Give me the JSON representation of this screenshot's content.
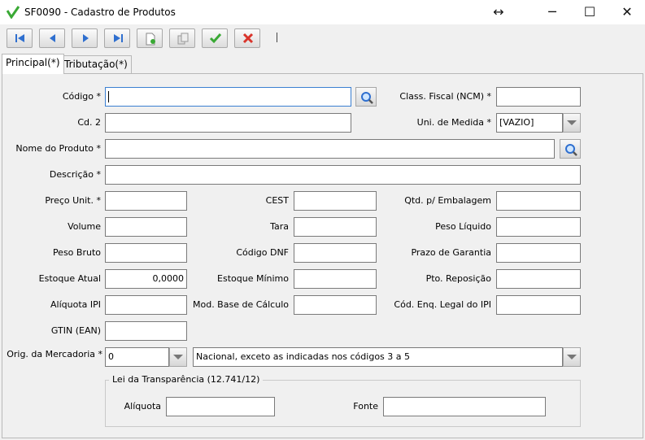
{
  "window": {
    "title": "SF0090 - Cadastro de Produtos",
    "resize_glyph": "↔",
    "minimize_glyph": "─",
    "maximize_glyph": "☐",
    "close_glyph": "✕"
  },
  "toolbar": {
    "buttons": [
      {
        "name": "first-record",
        "icon": "skip-first-icon"
      },
      {
        "name": "previous-record",
        "icon": "previous-icon"
      },
      {
        "name": "next-record",
        "icon": "next-icon"
      },
      {
        "name": "last-record",
        "icon": "skip-last-icon"
      },
      {
        "name": "new-record",
        "icon": "new-document-icon"
      },
      {
        "name": "copy-record",
        "icon": "copy-icon"
      },
      {
        "name": "confirm",
        "icon": "check-icon"
      },
      {
        "name": "cancel",
        "icon": "x-icon"
      }
    ],
    "separator": "|"
  },
  "tabs": [
    {
      "label": "Principal(*)",
      "active": true
    },
    {
      "label": "Tributação(*)",
      "active": false
    }
  ],
  "form": {
    "codigo": {
      "label": "Código *",
      "value": ""
    },
    "class_fiscal": {
      "label": "Class. Fiscal (NCM) *",
      "value": ""
    },
    "cd2": {
      "label": "Cd. 2",
      "value": ""
    },
    "uni_medida": {
      "label": "Uni. de Medida *",
      "value": "[VAZIO]"
    },
    "nome_produto": {
      "label": "Nome do Produto *",
      "value": ""
    },
    "descricao": {
      "label": "Descrição *",
      "value": ""
    },
    "preco_unit": {
      "label": "Preço Unit. *",
      "value": ""
    },
    "cest": {
      "label": "CEST",
      "value": ""
    },
    "qtd_embalagem": {
      "label": "Qtd. p/ Embalagem",
      "value": ""
    },
    "volume": {
      "label": "Volume",
      "value": ""
    },
    "tara": {
      "label": "Tara",
      "value": ""
    },
    "peso_liquido": {
      "label": "Peso Líquido",
      "value": ""
    },
    "peso_bruto": {
      "label": "Peso Bruto",
      "value": ""
    },
    "codigo_dnf": {
      "label": "Código DNF",
      "value": ""
    },
    "prazo_garantia": {
      "label": "Prazo de Garantia",
      "value": ""
    },
    "estoque_atual": {
      "label": "Estoque Atual",
      "value": "0,0000"
    },
    "estoque_minimo": {
      "label": "Estoque Mínimo",
      "value": ""
    },
    "pto_reposicao": {
      "label": "Pto. Reposição",
      "value": ""
    },
    "aliquota_ipi": {
      "label": "Alíquota IPI",
      "value": ""
    },
    "mod_base_calculo": {
      "label": "Mod. Base de Cálculo",
      "value": ""
    },
    "cod_enq_legal_ipi": {
      "label": "Cód. Enq. Legal do IPI",
      "value": ""
    },
    "gtin": {
      "label": "GTIN (EAN)",
      "value": ""
    },
    "orig_mercadoria": {
      "label": "Orig. da Mercadoria *",
      "code": "0",
      "description": "Nacional, exceto as indicadas nos códigos 3 a 5"
    }
  },
  "lei_transparencia": {
    "title": "Lei da Transparência (12.741/12)",
    "aliquota": {
      "label": "Alíquota",
      "value": ""
    },
    "fonte": {
      "label": "Fonte",
      "value": ""
    }
  },
  "colors": {
    "window_bg": "#f0f0f0",
    "focus_border": "#3b7fd1",
    "nav_blue": "#2f6fcf",
    "confirm_green": "#3aa935",
    "cancel_red": "#d9342b"
  }
}
